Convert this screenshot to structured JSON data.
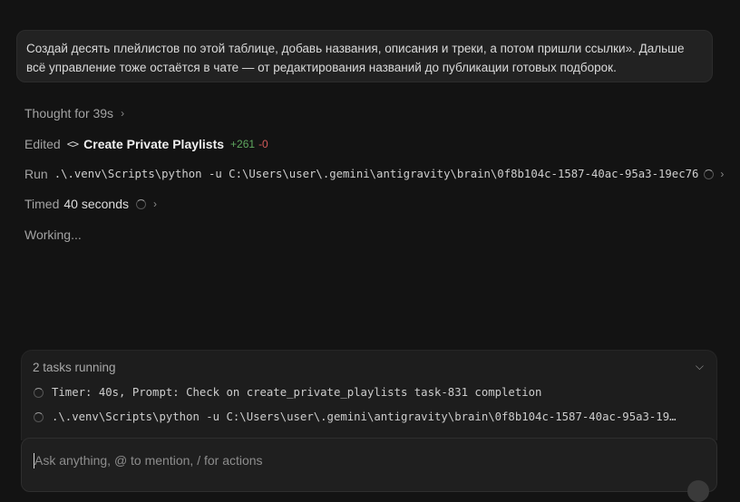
{
  "user_message": {
    "text": "Создай десять плейлистов по этой таблице, добавь названия, описания и треки, а потом пришли ссылки». Дальше всё управление тоже остаётся в чате — от редактирования названий до публикации готовых подборок."
  },
  "steps": {
    "thought": {
      "label": "Thought for 39s"
    },
    "edited": {
      "label": "Edited",
      "file": "Create Private Playlists",
      "added": "+261",
      "removed": "-0"
    },
    "run": {
      "label": "Run",
      "command": ".\\.venv\\Scripts\\python -u C:\\Users\\user\\.gemini\\antigravity\\brain\\0f8b104c-1587-40ac-95a3-19ec76"
    },
    "timed": {
      "label": "Timed",
      "duration": "40 seconds"
    },
    "working": {
      "label": "Working..."
    }
  },
  "tasks": {
    "header": "2 tasks running",
    "items": [
      {
        "text": "Timer: 40s, Prompt: Check on create_private_playlists task-831 completion"
      },
      {
        "text": ".\\.venv\\Scripts\\python -u C:\\Users\\user\\.gemini\\antigravity\\brain\\0f8b104c-1587-40ac-95a3-19…"
      }
    ]
  },
  "input": {
    "placeholder": "Ask anything, @ to mention, / for actions",
    "value": ""
  },
  "icons": {
    "thought_chevron": "chevron-right-icon",
    "code": "code-icon",
    "spinner": "spinner-icon",
    "collapse": "chevron-down-icon"
  }
}
